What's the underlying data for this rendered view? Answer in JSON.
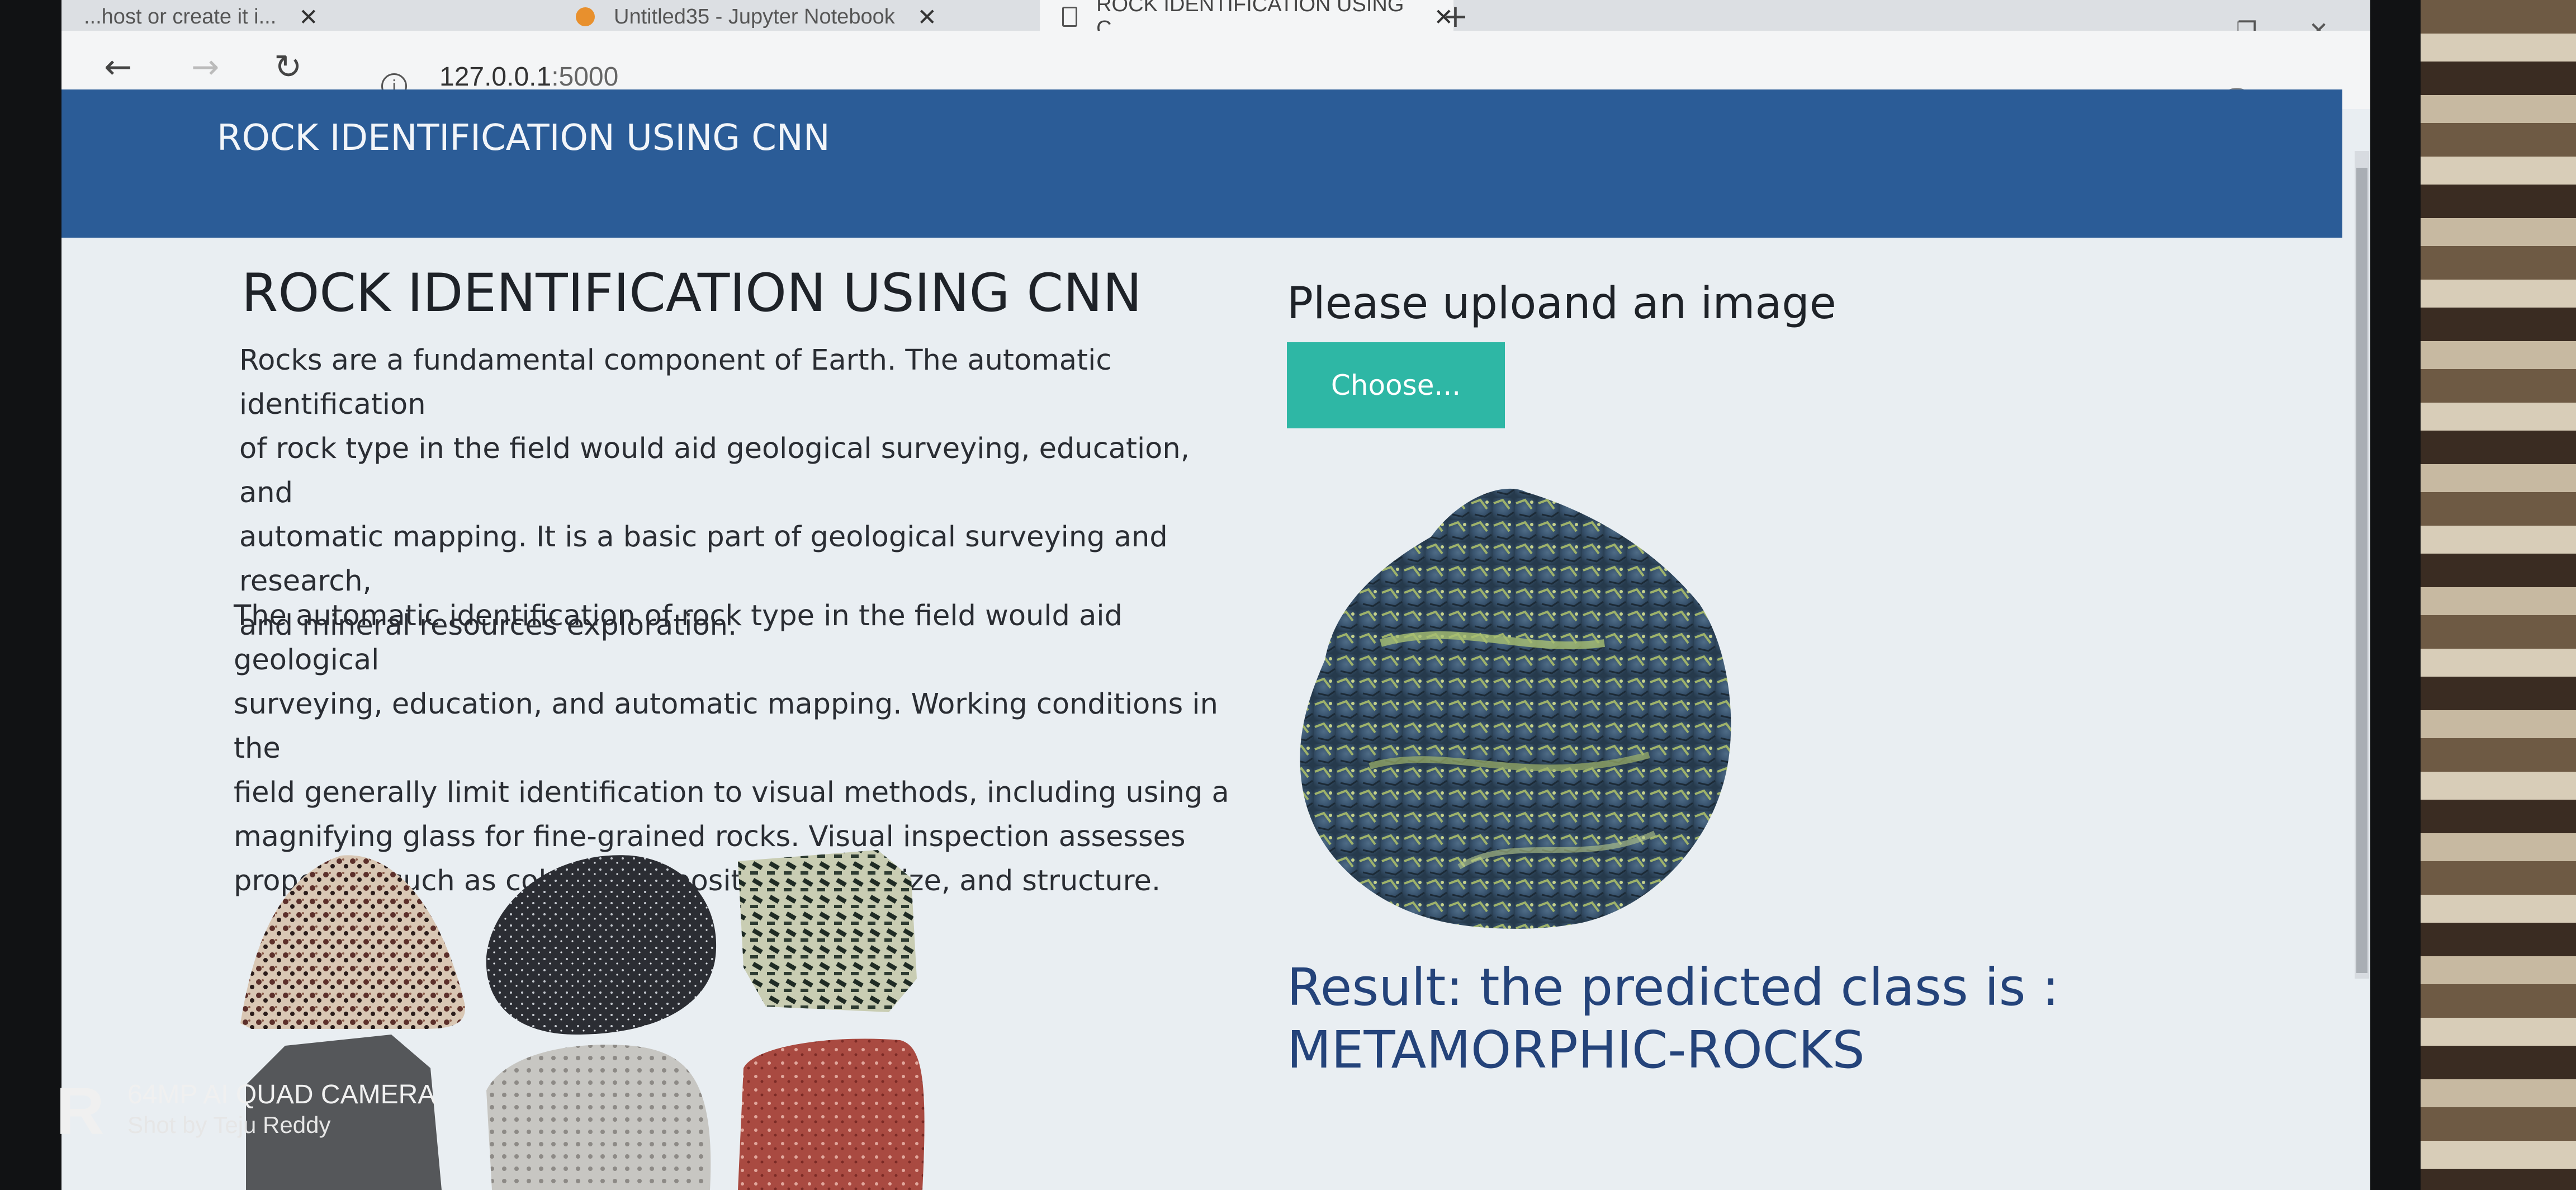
{
  "browser": {
    "tabs": [
      {
        "label": "...host or create it i...",
        "icon": "page-icon"
      },
      {
        "label": "Untitled35 - Jupyter Notebook",
        "icon": "jupyter-icon"
      },
      {
        "label": "ROCK IDENTIFICATION USING C",
        "icon": "page-icon",
        "active": true
      }
    ],
    "address": {
      "host": "127.0.0.1",
      "port": ":5000"
    }
  },
  "header": {
    "brand": "ROCK IDENTIFICATION USING CNN",
    "color": "#2b5c97"
  },
  "main": {
    "title": "ROCK IDENTIFICATION USING CNN",
    "paragraph1": [
      "Rocks are a fundamental component of Earth. The automatic identification",
      "of rock type in the field would aid geological surveying, education, and",
      "automatic mapping. It is a basic part of geological surveying and research,",
      "and mineral resources exploration."
    ],
    "paragraph2": [
      "The automatic identification of rock type in the field would aid geological",
      "surveying, education, and automatic mapping. Working conditions in the",
      "field generally limit identification to visual methods, including using a",
      "magnifying glass for fine-grained rocks. Visual inspection assesses",
      "properties such as colour, composition, grain size, and structure."
    ]
  },
  "upload": {
    "title": "Please uploand an image",
    "button_label": "Choose...",
    "button_color": "#2eb7a5"
  },
  "result": {
    "line1": "Result: the predicted class is :",
    "line2": "METAMORPHIC-ROCKS",
    "color": "#24437a"
  },
  "watermark": {
    "line1": "64MP AI QUAD CAMERA",
    "line2": "Shot by Teju Reddy"
  }
}
